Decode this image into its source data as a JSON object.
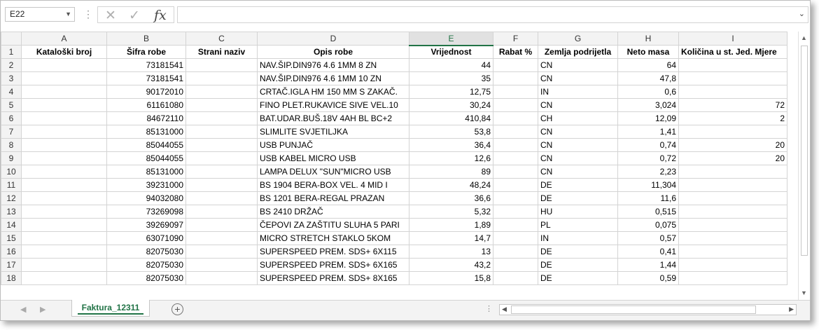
{
  "formula_bar": {
    "name_box": "E22",
    "cancel_icon": "✕",
    "enter_icon": "✓",
    "function_icon": "fx",
    "formula": ""
  },
  "columns": [
    "A",
    "B",
    "C",
    "D",
    "E",
    "F",
    "G",
    "H",
    "I"
  ],
  "selected_column": "E",
  "headers": [
    "Kataloški broj",
    "Šifra robe",
    "Strani naziv",
    "Opis robe",
    "Vrijednost",
    "Rabat %",
    "Zemlja podrijetla",
    "Neto masa",
    "Količina u st. Jed. Mjere"
  ],
  "rows": [
    {
      "n": "2",
      "a": "",
      "b": "73181541",
      "c": "",
      "d": "NAV.ŠIP.DIN976 4.6 1MM  8 ZN",
      "e": "44",
      "f": "",
      "g": "CN",
      "h": "64",
      "i": ""
    },
    {
      "n": "3",
      "a": "",
      "b": "73181541",
      "c": "",
      "d": "NAV.ŠIP.DIN976 4.6 1MM 10 ZN",
      "e": "35",
      "f": "",
      "g": "CN",
      "h": "47,8",
      "i": ""
    },
    {
      "n": "4",
      "a": "",
      "b": "90172010",
      "c": "",
      "d": "CRTAČ.IGLA HM 150 MM S ZAKAČ.",
      "e": "12,75",
      "f": "",
      "g": "IN",
      "h": "0,6",
      "i": ""
    },
    {
      "n": "5",
      "a": "",
      "b": "61161080",
      "c": "",
      "d": "FINO PLET.RUKAVICE SIVE VEL.10",
      "e": "30,24",
      "f": "",
      "g": "CN",
      "h": "3,024",
      "i": "72"
    },
    {
      "n": "6",
      "a": "",
      "b": "84672110",
      "c": "",
      "d": "BAT.UDAR.BUŠ.18V 4AH BL BC+2",
      "e": "410,84",
      "f": "",
      "g": "CH",
      "h": "12,09",
      "i": "2"
    },
    {
      "n": "7",
      "a": "",
      "b": "85131000",
      "c": "",
      "d": "SLIMLITE SVJETILJKA",
      "e": "53,8",
      "f": "",
      "g": "CN",
      "h": "1,41",
      "i": ""
    },
    {
      "n": "8",
      "a": "",
      "b": "85044055",
      "c": "",
      "d": "USB PUNJAČ",
      "e": "36,4",
      "f": "",
      "g": "CN",
      "h": "0,74",
      "i": "20"
    },
    {
      "n": "9",
      "a": "",
      "b": "85044055",
      "c": "",
      "d": "USB KABEL MICRO USB",
      "e": "12,6",
      "f": "",
      "g": "CN",
      "h": "0,72",
      "i": "20"
    },
    {
      "n": "10",
      "a": "",
      "b": "85131000",
      "c": "",
      "d": "LAMPA DELUX \"SUN\"MICRO USB",
      "e": "89",
      "f": "",
      "g": "CN",
      "h": "2,23",
      "i": ""
    },
    {
      "n": "11",
      "a": "",
      "b": "39231000",
      "c": "",
      "d": "BS 1904 BERA-BOX VEL. 4 MID I",
      "e": "48,24",
      "f": "",
      "g": "DE",
      "h": "11,304",
      "i": ""
    },
    {
      "n": "12",
      "a": "",
      "b": "94032080",
      "c": "",
      "d": "BS 1201 BERA-REGAL PRAZAN",
      "e": "36,6",
      "f": "",
      "g": "DE",
      "h": "11,6",
      "i": ""
    },
    {
      "n": "13",
      "a": "",
      "b": "73269098",
      "c": "",
      "d": "BS 2410 DRŽAČ",
      "e": "5,32",
      "f": "",
      "g": "HU",
      "h": "0,515",
      "i": ""
    },
    {
      "n": "14",
      "a": "",
      "b": "39269097",
      "c": "",
      "d": "ČEPOVI ZA ZAŠTITU SLUHA 5 PARI",
      "e": "1,89",
      "f": "",
      "g": "PL",
      "h": "0,075",
      "i": ""
    },
    {
      "n": "15",
      "a": "",
      "b": "63071090",
      "c": "",
      "d": "MICRO STRETCH STAKLO 5KOM",
      "e": "14,7",
      "f": "",
      "g": "IN",
      "h": "0,57",
      "i": ""
    },
    {
      "n": "16",
      "a": "",
      "b": "82075030",
      "c": "",
      "d": "SUPERSPEED PREM. SDS+ 6X115",
      "e": "13",
      "f": "",
      "g": "DE",
      "h": "0,41",
      "i": ""
    },
    {
      "n": "17",
      "a": "",
      "b": "82075030",
      "c": "",
      "d": "SUPERSPEED PREM. SDS+ 6X165",
      "e": "43,2",
      "f": "",
      "g": "DE",
      "h": "1,44",
      "i": ""
    },
    {
      "n": "18",
      "a": "",
      "b": "82075030",
      "c": "",
      "d": "SUPERSPEED PREM. SDS+ 8X165",
      "e": "15,8",
      "f": "",
      "g": "DE",
      "h": "0,59",
      "i": ""
    }
  ],
  "sheet_tab": "Faktura_12311",
  "add_sheet_icon": "⊕",
  "colors": {
    "accent": "#217346",
    "grid": "#d4d4d4",
    "header_bg": "#f3f3f3"
  }
}
